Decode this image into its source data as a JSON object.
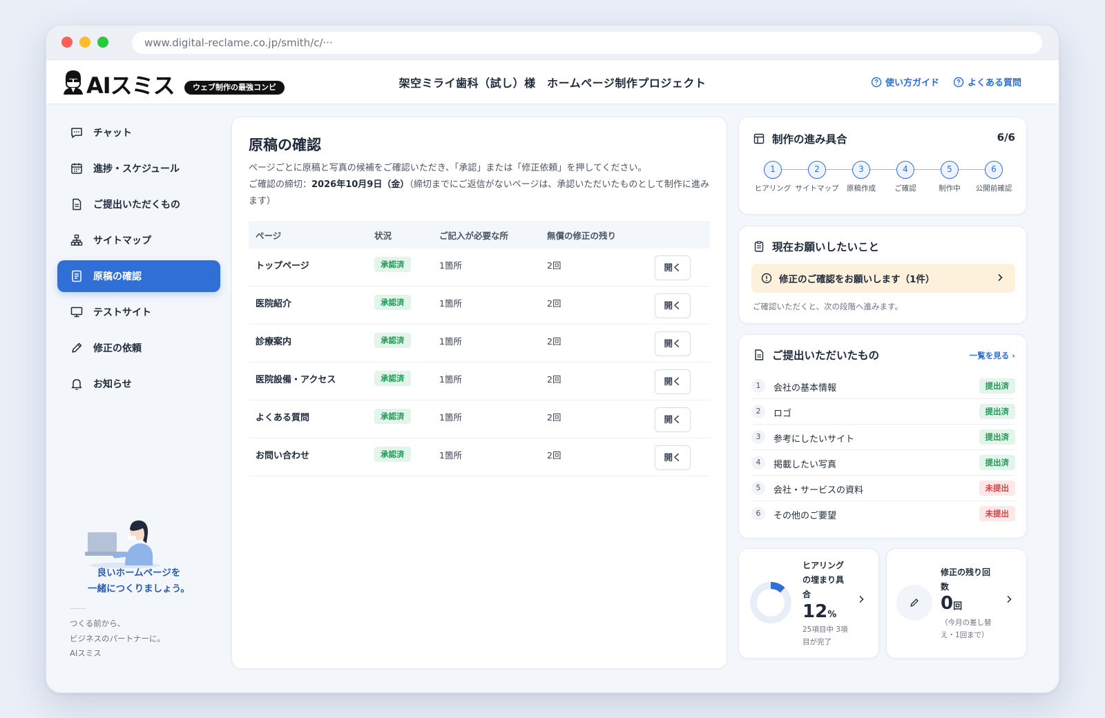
{
  "browser": {
    "url": "www.digital-reclame.co.jp/smith/c/···"
  },
  "header": {
    "logo_text": "AIスミス",
    "logo_tag": "ウェブ制作の最強コンビ",
    "project_title": "架空ミライ歯科（試し）様　ホームページ制作プロジェクト",
    "guide_link": "使い方ガイド",
    "faq_link": "よくある質問",
    "accent_color": "#2f6fd6"
  },
  "sidebar": {
    "items": [
      {
        "label": "チャット",
        "icon": "chat-icon"
      },
      {
        "label": "進捗・スケジュール",
        "icon": "calendar-icon"
      },
      {
        "label": "ご提出いただくもの",
        "icon": "document-icon"
      },
      {
        "label": "サイトマップ",
        "icon": "sitemap-icon"
      },
      {
        "label": "原稿の確認",
        "icon": "manuscript-icon",
        "active": true
      },
      {
        "label": "テストサイト",
        "icon": "monitor-icon"
      },
      {
        "label": "修正の依頼",
        "icon": "pencil-icon"
      },
      {
        "label": "お知らせ",
        "icon": "bell-icon"
      }
    ],
    "tagline_1": "良いホームページを",
    "tagline_2": "一緒につくりましょう。",
    "footer_1": "つくる前から、",
    "footer_2": "ビジネスのパートナーに。",
    "footer_3": "AIスミス"
  },
  "main": {
    "title": "原稿の確認",
    "desc_1": "ページごとに原稿と写真の候補をご確認いただき、「承認」または「修正依頼」を押してください。",
    "deadline_label": "ご確認の締切：",
    "deadline_value": "2026年10月9日（金）",
    "deadline_note": "（締切までにご返信がないページは、承認いただいたものとして制作に進みます）",
    "columns": [
      "ページ",
      "状況",
      "ご記入が必要な所",
      "無償の修正の残り"
    ],
    "open_label": "開く",
    "rows": [
      {
        "page": "トップページ",
        "status": "承認済",
        "required": "1箇所",
        "remaining": "2回"
      },
      {
        "page": "医院紹介",
        "status": "承認済",
        "required": "1箇所",
        "remaining": "2回"
      },
      {
        "page": "診療案内",
        "status": "承認済",
        "required": "1箇所",
        "remaining": "2回"
      },
      {
        "page": "医院設備・アクセス",
        "status": "承認済",
        "required": "1箇所",
        "remaining": "2回"
      },
      {
        "page": "よくある質問",
        "status": "承認済",
        "required": "1箇所",
        "remaining": "2回"
      },
      {
        "page": "お問い合わせ",
        "status": "承認済",
        "required": "1箇所",
        "remaining": "2回"
      }
    ]
  },
  "progress": {
    "title": "制作の進み具合",
    "count": "6/6",
    "steps": [
      {
        "num": "1",
        "label": "ヒアリング"
      },
      {
        "num": "2",
        "label": "サイトマップ"
      },
      {
        "num": "3",
        "label": "原稿作成"
      },
      {
        "num": "4",
        "label": "ご確認"
      },
      {
        "num": "5",
        "label": "制作中"
      },
      {
        "num": "6",
        "label": "公開前確認"
      }
    ]
  },
  "request": {
    "title": "現在お願いしたいこと",
    "banner": "修正のご確認をお願いします（1件）",
    "note": "ご確認いただくと、次の段階へ進みます。"
  },
  "submissions": {
    "title": "ご提出いただいたもの",
    "see_all": "一覧を見る ›",
    "items": [
      {
        "num": "1",
        "name": "会社の基本情報",
        "status": "提出済",
        "ok": true
      },
      {
        "num": "2",
        "name": "ロゴ",
        "status": "提出済",
        "ok": true
      },
      {
        "num": "3",
        "name": "参考にしたいサイト",
        "status": "提出済",
        "ok": true
      },
      {
        "num": "4",
        "name": "掲載したい写真",
        "status": "提出済",
        "ok": true
      },
      {
        "num": "5",
        "name": "会社・サービスの資料",
        "status": "未提出",
        "ok": false
      },
      {
        "num": "6",
        "name": "その他のご要望",
        "status": "未提出",
        "ok": false
      }
    ]
  },
  "hearing": {
    "label_1": "ヒアリング",
    "label_2": "の埋まり具",
    "label_3": "合",
    "percent": 12,
    "percent_value": "12",
    "percent_unit": "%",
    "sub_1": "25項目中 3項",
    "sub_2": "目が完了"
  },
  "revisions": {
    "label_1": "修正の残り回",
    "label_2": "数",
    "value": "0",
    "unit": "回",
    "sub_1": "（今月の差し替",
    "sub_2": "え・1回まで）"
  }
}
